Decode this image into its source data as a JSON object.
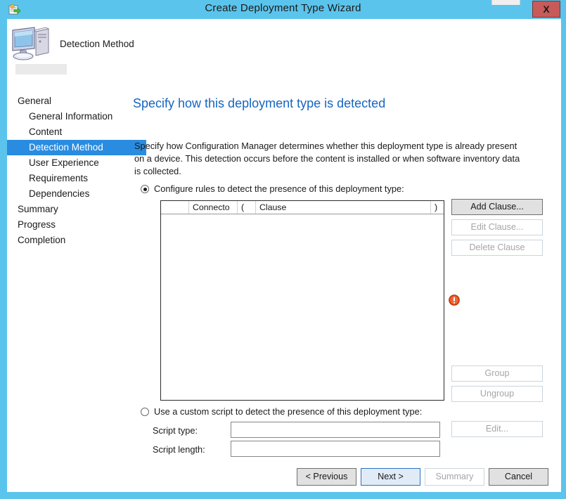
{
  "window": {
    "title": "Create Deployment Type Wizard",
    "close_label": "X",
    "app_icon": "deployment-package-icon",
    "frame_color": "#5bc4ec",
    "close_color": "#c85a5a"
  },
  "header": {
    "icon": "computer-icon",
    "label": "Detection Method"
  },
  "sidebar": {
    "items": [
      {
        "label": "General",
        "level": 0,
        "selected": false
      },
      {
        "label": "General Information",
        "level": 1,
        "selected": false
      },
      {
        "label": "Content",
        "level": 1,
        "selected": false
      },
      {
        "label": "Detection Method",
        "level": 1,
        "selected": true
      },
      {
        "label": "User Experience",
        "level": 1,
        "selected": false
      },
      {
        "label": "Requirements",
        "level": 1,
        "selected": false
      },
      {
        "label": "Dependencies",
        "level": 1,
        "selected": false
      },
      {
        "label": "Summary",
        "level": 0,
        "selected": false
      },
      {
        "label": "Progress",
        "level": 0,
        "selected": false
      },
      {
        "label": "Completion",
        "level": 0,
        "selected": false
      }
    ],
    "selected_color": "#2a8ce0"
  },
  "main": {
    "title": "Specify how this deployment type is detected",
    "title_color": "#1566c0",
    "description": "Specify how Configuration Manager determines whether this deployment type is already present on a device. This detection occurs before the content is installed or when software inventory data is collected.",
    "option_rules": {
      "label": "Configure rules to detect the presence of this deployment type:",
      "checked": true
    },
    "option_script": {
      "label": "Use a custom script to detect the presence of this deployment type:",
      "checked": false
    },
    "rules_table": {
      "columns": [
        "",
        "Connecto",
        "(",
        "Clause",
        ")"
      ],
      "rows": []
    },
    "clause_buttons": [
      {
        "label": "Add Clause...",
        "enabled": true
      },
      {
        "label": "Edit Clause...",
        "enabled": false
      },
      {
        "label": "Delete Clause",
        "enabled": false
      }
    ],
    "group_buttons": [
      {
        "label": "Group",
        "enabled": false
      },
      {
        "label": "Ungroup",
        "enabled": false
      }
    ],
    "validation_icon": "error-icon",
    "validation_icon_color": "#e24a18",
    "script_fields": [
      {
        "label": "Script type:",
        "value": "",
        "placeholder": ""
      },
      {
        "label": "Script length:",
        "value": "",
        "placeholder": ""
      }
    ],
    "edit_button": {
      "label": "Edit...",
      "enabled": false
    }
  },
  "footer": {
    "buttons": [
      {
        "label": "< Previous",
        "enabled": true,
        "default": false
      },
      {
        "label": "Next >",
        "enabled": true,
        "default": true
      },
      {
        "label": "Summary",
        "enabled": false,
        "default": false
      },
      {
        "label": "Cancel",
        "enabled": true,
        "default": false
      }
    ]
  }
}
